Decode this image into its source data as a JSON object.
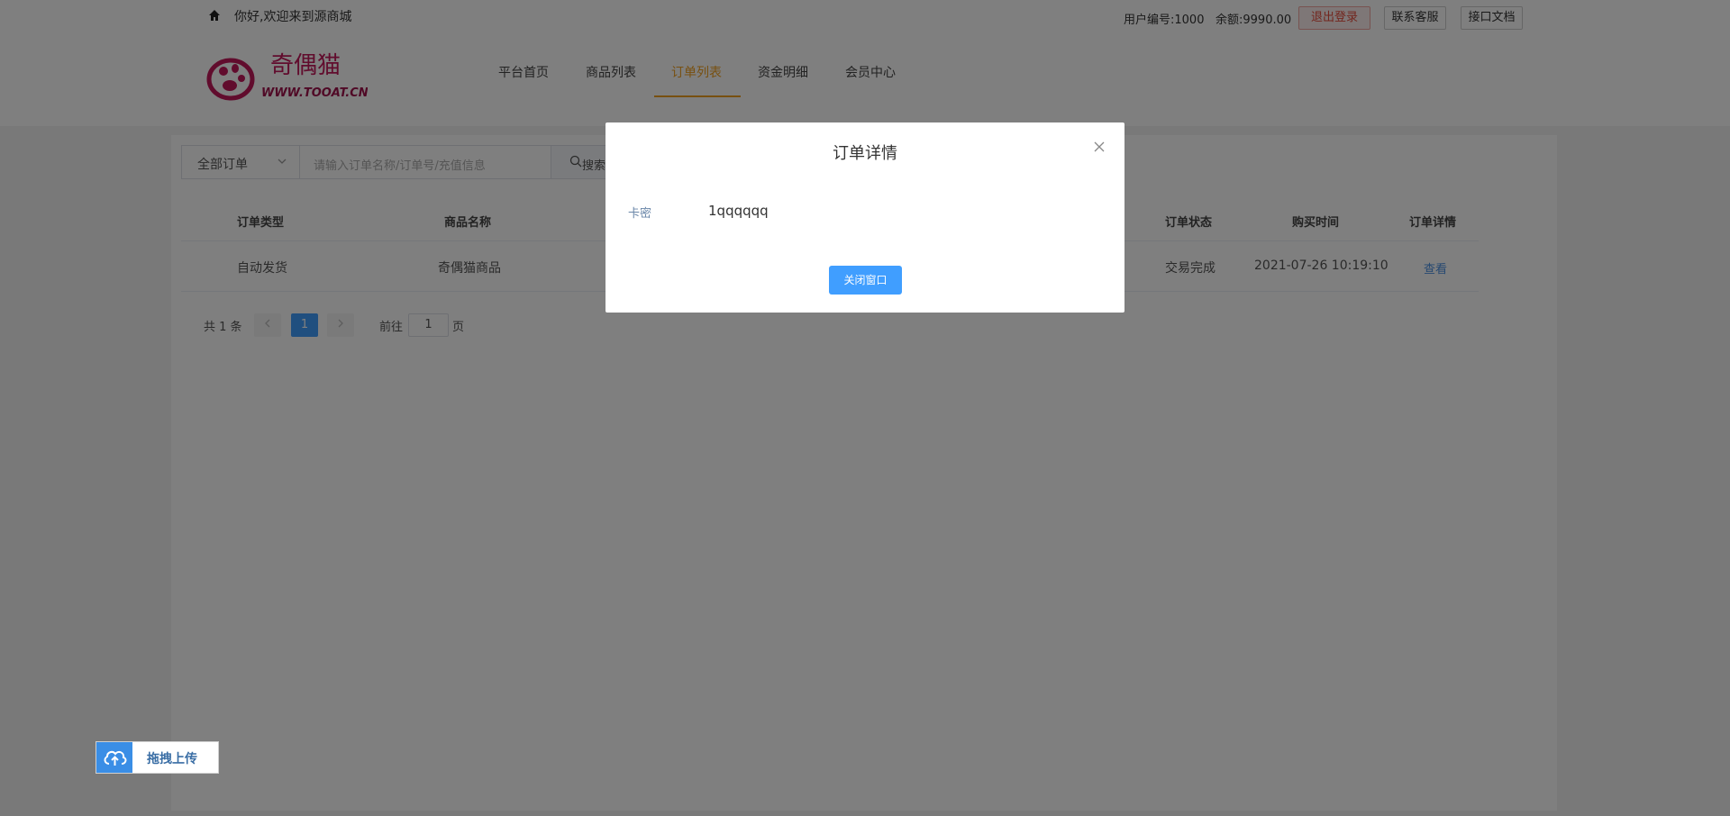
{
  "topbar": {
    "welcome": "你好,欢迎来到源商城",
    "user_id": "用户编号:1000",
    "balance": "余额:9990.00",
    "logout": "退出登录",
    "service": "联系客服",
    "docs": "接口文档"
  },
  "logo": {
    "cn": "奇偶猫",
    "url": "WWW.TOOAT.CN"
  },
  "nav": [
    "平台首页",
    "商品列表",
    "订单列表",
    "资金明细",
    "会员中心"
  ],
  "filter": {
    "select_value": "全部订单",
    "search_placeholder": "请输入订单名称/订单号/充值信息",
    "search_button": "搜索"
  },
  "table": {
    "headers": {
      "type": "订单类型",
      "name": "商品名称",
      "status": "订单状态",
      "time": "购买时间",
      "detail": "订单详情"
    },
    "rows": [
      {
        "type": "自动发货",
        "name": "奇偶猫商品",
        "status": "交易完成",
        "time": "2021-07-26 10:19:10",
        "detail": "查看"
      }
    ]
  },
  "pager": {
    "total": "共 1 条",
    "current": "1",
    "goto": "前往",
    "input": "1",
    "page": "页",
    "prev_icon": "chevron-left-icon",
    "next_icon": "chevron-right-icon"
  },
  "modal": {
    "title": "订单详情",
    "label": "卡密",
    "value": "1qqqqqq",
    "button": "关闭窗口",
    "close_icon": "close-icon"
  },
  "upload": {
    "label": "拖拽上传",
    "icon": "cloud-upload-icon"
  },
  "colors": {
    "accent": "#409eff",
    "nav_active": "#f0a020",
    "danger": "#e74c3c",
    "overlay": "rgba(0,0,0,0.5)"
  }
}
